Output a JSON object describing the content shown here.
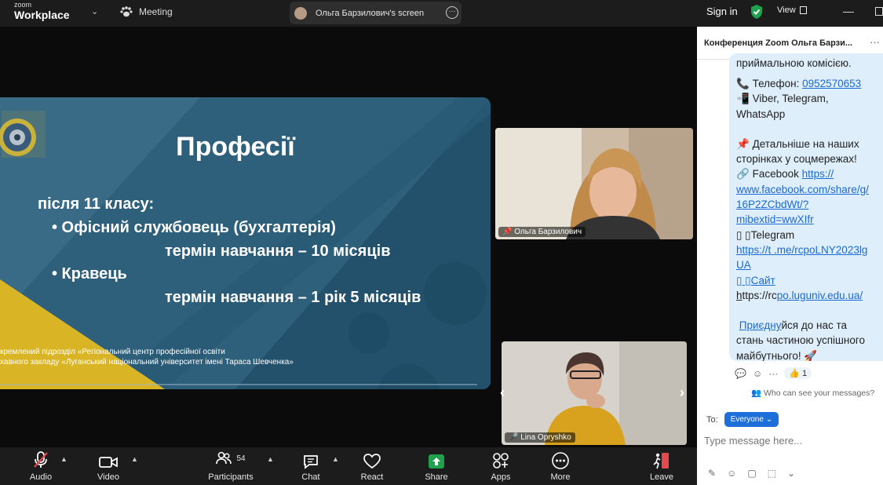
{
  "topbar": {
    "logo_small": "zoom",
    "logo_big": "Workplace",
    "meeting_label": "Meeting",
    "screen_label": "Ольга Барзилович's screen",
    "signin": "Sign in",
    "view_label": "View"
  },
  "slide": {
    "title": "Професії",
    "line1": "після 11 класу:",
    "line2": "• Офісний службовець (бухгалтерія)",
    "line3": "термін навчання – 10 місяців",
    "line4": "• Кравець",
    "line5": "термін навчання – 1 рік 5 місяців",
    "foot1": "кремлений підрозділ «Регіональний центр професійної освіти",
    "foot2": "хавного закладу «Луганський національний університет імені Тараса Шевченка»"
  },
  "participants": {
    "top_name": "Ольга Барзилович",
    "bottom_name": "Lina Opryshko"
  },
  "toolbar": {
    "audio": "Audio",
    "video": "Video",
    "participants": "Participants",
    "participants_count": "54",
    "chat": "Chat",
    "react": "React",
    "share": "Share",
    "apps": "Apps",
    "more": "More",
    "leave": "Leave"
  },
  "chat": {
    "title": "Конференция Zoom Ольга Барзи...",
    "cut_line": "приймальною комісією.",
    "phone_label": "Телефон: ",
    "phone": "0952570653",
    "viber": "Viber, Telegram,",
    "whatsapp": "WhatsApp",
    "details1": "Детальніше на наших",
    "details2": "сторінках у соцмережах!",
    "facebook_label": "Facebook ",
    "fb1": "https://",
    "fb2": "www.facebook.com/share/g/",
    "fb3": "16P2ZCbdWt/?",
    "fb4": "mibextid=wwXIfr",
    "tg_label": "Telegram",
    "tg1": "https://t .me/rcpoLNY2023lg",
    "tg2": "UA",
    "site_label": "Сайт",
    "site_h": "h",
    "site_https": "ttps://rc",
    "site_link": "po.luguniv.edu.ua/",
    "join_link": "Приєдну",
    "join_rest": "йся до нас та",
    "join2": "стань частиною успішного",
    "join3": "майбутнього!",
    "reaction_count": "1",
    "who_text": "Who can see your messages?",
    "to_label": "To:",
    "to_value": "Everyone",
    "placeholder": "Type message here..."
  },
  "colors": {
    "slide_bg": "#2e5f7b",
    "slide_dark": "#1f4a64",
    "slide_yellow": "#d9b526",
    "share_green": "#1fa14d",
    "leave_red": "#e5484d",
    "accent_blue": "#1e6fd9",
    "shield_green": "#1fa14d"
  }
}
